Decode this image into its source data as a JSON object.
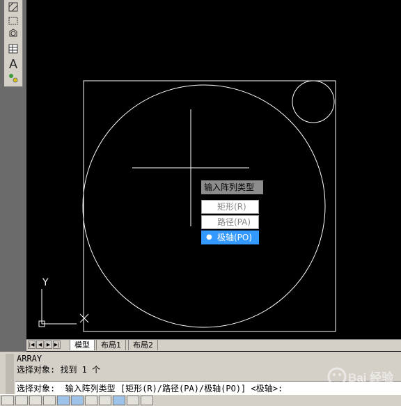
{
  "toolbar": {
    "icons": [
      "hatch-icon",
      "region-icon",
      "table-icon",
      "multiline-text-icon",
      "add-selected-icon"
    ],
    "text_tool_glyph": "A"
  },
  "drawing": {
    "ucs": {
      "y_label": "Y"
    }
  },
  "popup": {
    "title": "输入阵列类型",
    "options": [
      {
        "label": "矩形(R)",
        "selected": false
      },
      {
        "label": "路径(PA)",
        "selected": false
      },
      {
        "label": "极轴(PO)",
        "selected": true
      }
    ],
    "bullet": "●"
  },
  "tabs": {
    "nav": [
      "|◀",
      "◀",
      "▶",
      "▶|"
    ],
    "items": [
      {
        "label": "模型",
        "active": true
      },
      {
        "label": "布局1",
        "active": false
      },
      {
        "label": "布局2",
        "active": false
      }
    ]
  },
  "command": {
    "history": [
      "ARRAY",
      "选择对象: 找到 1 个"
    ],
    "prompt": "选择对象:  输入阵列类型 [矩形(R)/路径(PA)/极轴(PO)] <极轴>:"
  },
  "watermark": {
    "text": "Bai 经验"
  },
  "colors": {
    "background": "#000000",
    "linework": "#ffffff",
    "selected": "#3399ff",
    "panel": "#d4d0c8"
  }
}
